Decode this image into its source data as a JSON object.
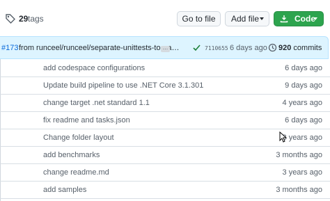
{
  "header": {
    "tags_count": "29",
    "tags_label": "tags",
    "goto_file_label": "Go to file",
    "add_file_label": "Add file",
    "code_label": "Code"
  },
  "latest_commit": {
    "pr_number": "#173",
    "message": "from runceel/runceel/separate-unittests-to-ea…",
    "ellipsis": "…",
    "sha": "7110655",
    "time": "6 days ago",
    "commit_count": "920",
    "commits_label": "commits"
  },
  "rows": [
    {
      "message": "add codespace configurations",
      "age": "6 days ago"
    },
    {
      "message": "Update build pipeline to use .NET Core 3.1.301",
      "age": "9 days ago"
    },
    {
      "message": "change target .net standard 1.1",
      "age": "4 years ago"
    },
    {
      "message": "fix readme and tasks.json",
      "age": "6 days ago"
    },
    {
      "message": "Change folder layout",
      "age": "3 years ago"
    },
    {
      "message": "add benchmarks",
      "age": "3 months ago"
    },
    {
      "message": "change readme.md",
      "age": "3 years ago"
    },
    {
      "message": "add samples",
      "age": "3 months ago"
    }
  ],
  "icons": [
    "tag-icon",
    "download-icon",
    "check-icon",
    "history-icon",
    "mouse-cursor-icon"
  ],
  "colors": {
    "code_button": "#2da44e",
    "commit_bar": "#ddf4ff",
    "link": "#0969da",
    "muted_text": "#57606a"
  }
}
